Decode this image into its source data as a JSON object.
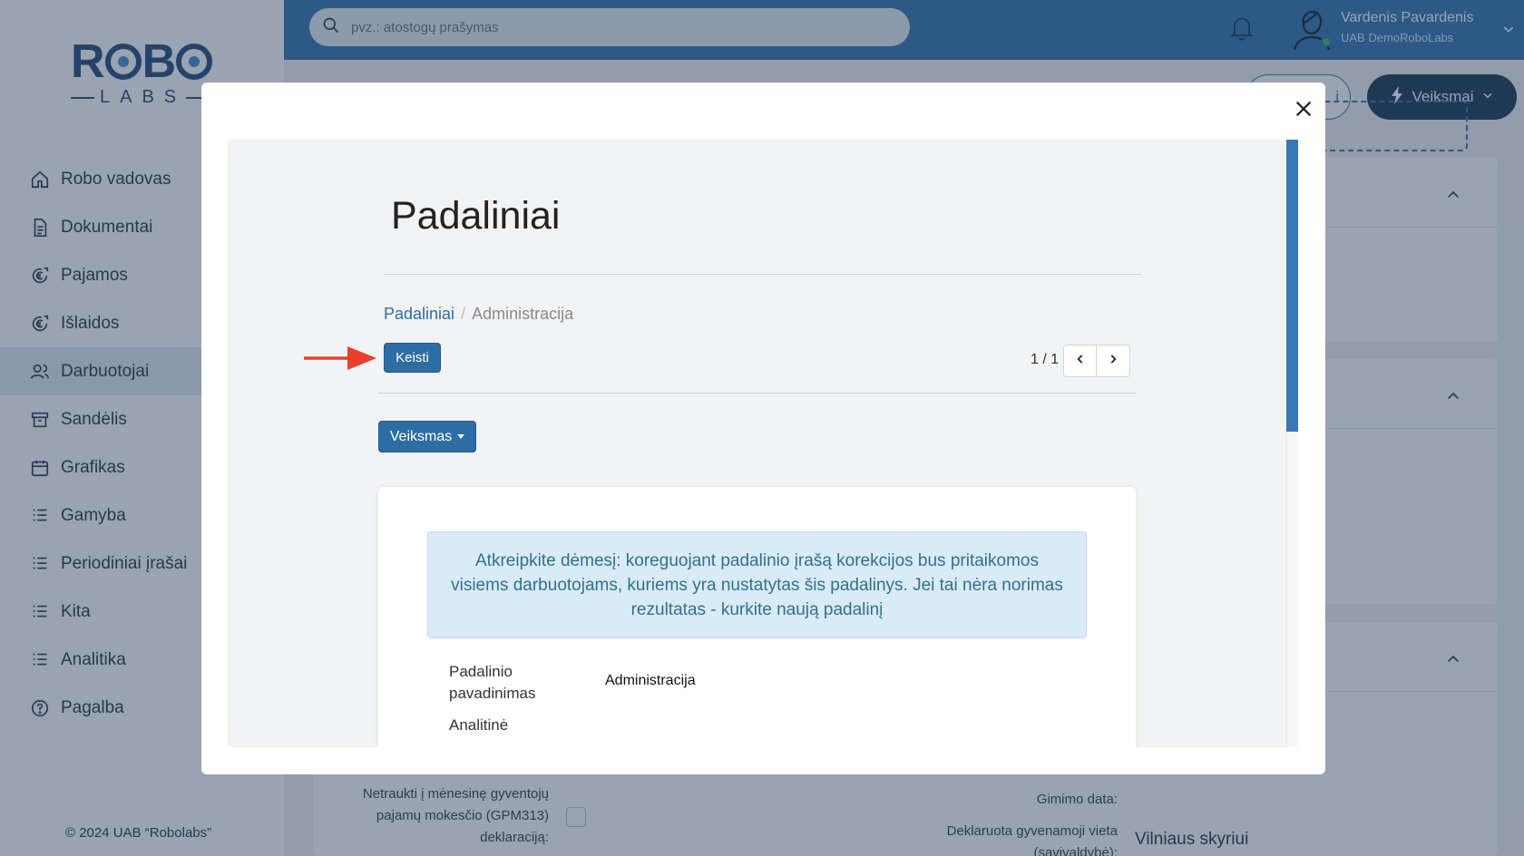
{
  "sidebar": {
    "logo_top": [
      "R",
      "B"
    ],
    "logo_bottom": "LABS",
    "items": [
      {
        "label": "Robo vadovas",
        "icon": "home-icon"
      },
      {
        "label": "Dokumentai",
        "icon": "document-icon"
      },
      {
        "label": "Pajamos",
        "icon": "euro-in-icon"
      },
      {
        "label": "Išlaidos",
        "icon": "euro-out-icon"
      },
      {
        "label": "Darbuotojai",
        "icon": "users-icon",
        "active": true
      },
      {
        "label": "Sandėlis",
        "icon": "archive-icon"
      },
      {
        "label": "Grafikas",
        "icon": "calendar-icon"
      },
      {
        "label": "Gamyba",
        "icon": "list-icon"
      },
      {
        "label": "Periodiniai įrašai",
        "icon": "list-icon"
      },
      {
        "label": "Kita",
        "icon": "list-icon"
      },
      {
        "label": "Analitika",
        "icon": "list-icon"
      },
      {
        "label": "Pagalba",
        "icon": "help-icon"
      }
    ],
    "copyright": "© 2024 UAB “Robolabs”"
  },
  "topbar": {
    "search_placeholder": "pvz.: atostogų prašymas",
    "user_name": "Vardenis Pavardenis",
    "user_company": "UAB DemoRoboLabs"
  },
  "page": {
    "outline_button": "i",
    "actions_button": "Veiksmai",
    "bg_fields": {
      "gpm_label_1": "Netraukti į mėnesinę gyventojų",
      "gpm_label_2": "pajamų mokesčio (GPM313)",
      "gpm_label_3": "deklaraciją:",
      "birth_label": "Gimimo data:",
      "residence_label_1": "Deklaruota gyvenamoji vieta",
      "residence_label_2": "(savivaldybė):",
      "residence_value": "Vilniaus skyriui"
    }
  },
  "modal": {
    "title": "Padaliniai",
    "breadcrumb": {
      "parent": "Padaliniai",
      "separator": "/",
      "current": "Administracija"
    },
    "edit_button": "Keisti",
    "pager": "1 / 1",
    "action_button": "Veiksmas",
    "alert_text": "Atkreipkite dėmesį: koreguojant padalinio įrašą korekcijos bus pritaikomos visiems darbuotojams, kuriems yra nustatytas šis padalinys. Jei tai nėra norimas rezultatas - kurkite naują padalinį",
    "fields": {
      "name_label_1": "Padalinio",
      "name_label_2": "pavadinimas",
      "name_value": "Administracija",
      "analytic_label": "Analitinė"
    },
    "scroll_position": 0.0
  },
  "colors": {
    "primary": "#2e6da4",
    "topbar": "#3a78b5",
    "annotation_arrow": "#e8402a",
    "alert_bg": "#d9ebf7",
    "alert_text": "#31708f"
  }
}
